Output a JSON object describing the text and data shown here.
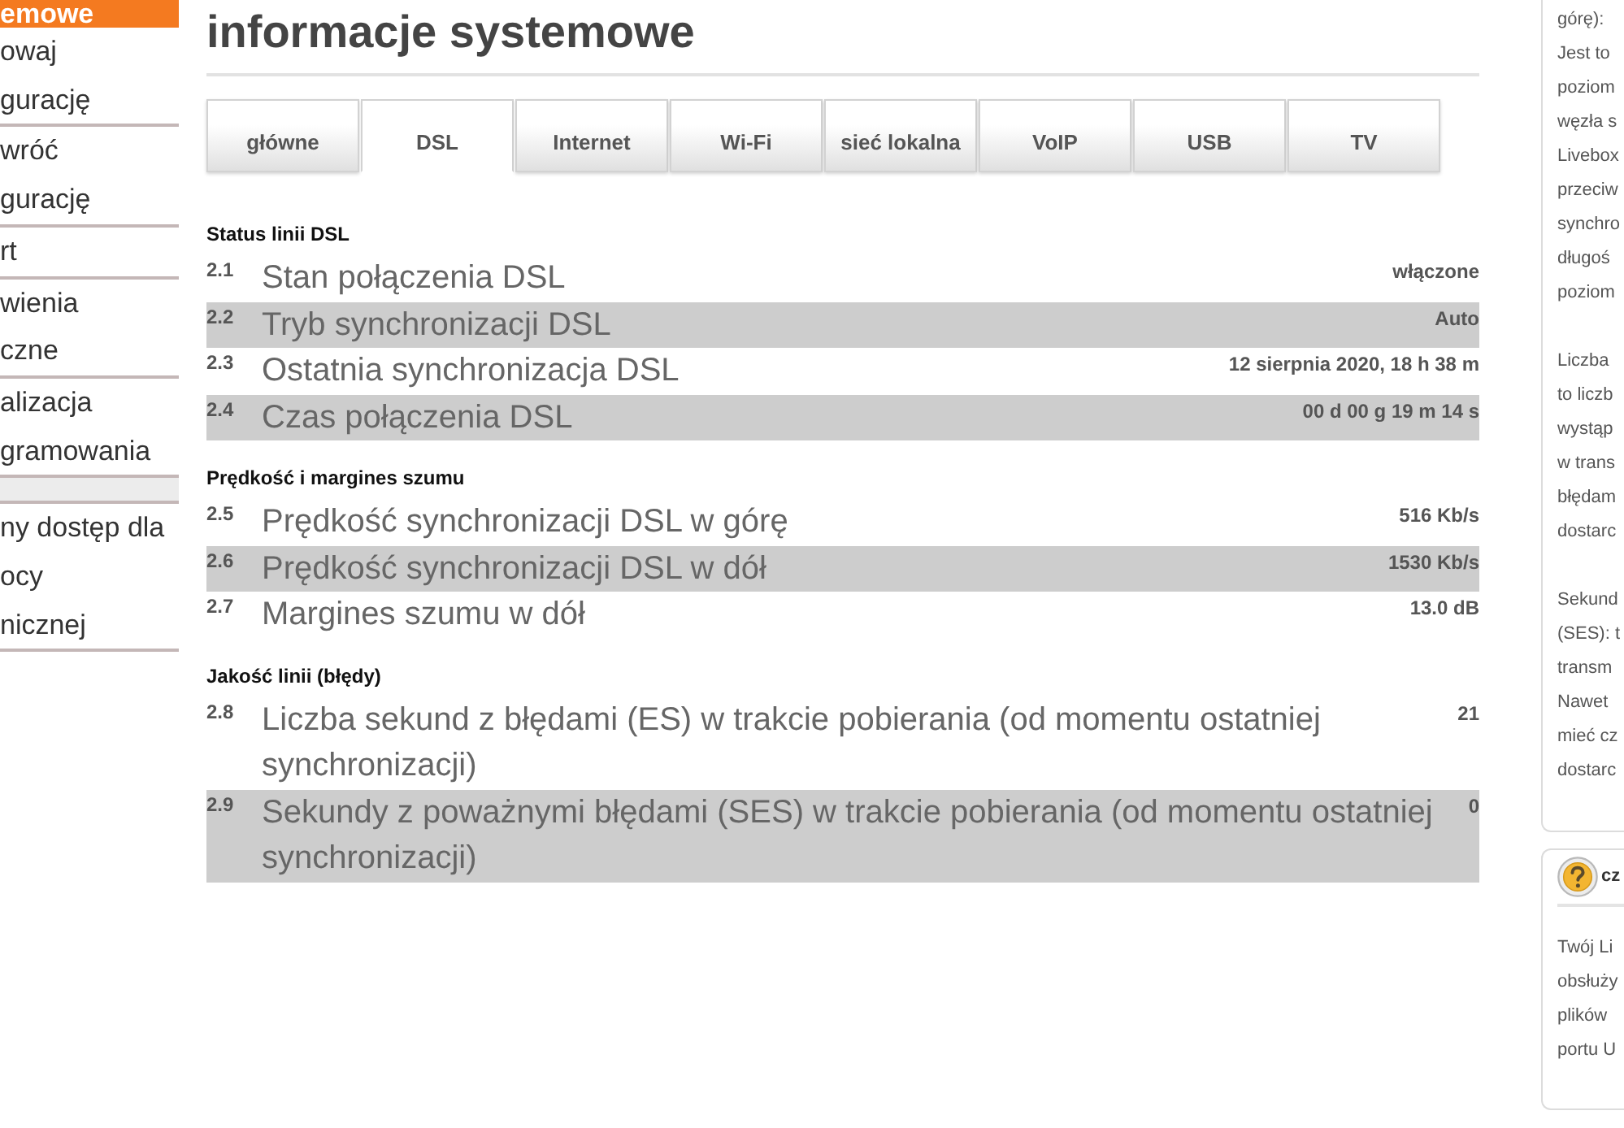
{
  "sidebar": {
    "groups": [
      {
        "items": [
          {
            "lines": [
              "emowe"
            ],
            "selected": true
          },
          {
            "lines": [
              "owaj",
              "gurację"
            ],
            "selected": false
          },
          {
            "lines": [
              "wróć",
              "gurację"
            ],
            "selected": false
          },
          {
            "lines": [
              "rt"
            ],
            "selected": false
          },
          {
            "lines": [
              "wienia",
              "czne"
            ],
            "selected": false
          },
          {
            "lines": [
              "alizacja",
              "gramowania"
            ],
            "selected": false
          }
        ]
      },
      {
        "items": [
          {
            "lines": [
              "ny dostęp dla",
              "ocy",
              "nicznej"
            ],
            "selected": false
          }
        ]
      }
    ]
  },
  "title": "informacje systemowe",
  "tabs": [
    {
      "label": "główne",
      "selected": false
    },
    {
      "label": "DSL",
      "selected": true
    },
    {
      "label": "Internet",
      "selected": false
    },
    {
      "label": "Wi-Fi",
      "selected": false
    },
    {
      "label": "sieć lokalna",
      "selected": false
    },
    {
      "label": "VoIP",
      "selected": false
    },
    {
      "label": "USB",
      "selected": false
    },
    {
      "label": "TV",
      "selected": false
    }
  ],
  "sections": [
    {
      "heading": "Status linii DSL",
      "rows": [
        {
          "number": "2.1",
          "label": "Stan połączenia DSL",
          "value": "włączone"
        },
        {
          "number": "2.2",
          "label": "Tryb synchronizacji DSL",
          "value": "Auto"
        },
        {
          "number": "2.3",
          "label": "Ostatnia synchronizacja DSL",
          "value": "12 sierpnia 2020, 18 h 38 m"
        },
        {
          "number": "2.4",
          "label": "Czas połączenia DSL",
          "value": "00 d 00 g 19 m 14 s"
        }
      ]
    },
    {
      "heading": "Prędkość i margines szumu",
      "rows": [
        {
          "number": "2.5",
          "label": "Prędkość synchronizacji DSL w górę",
          "value": "516 Kb/s"
        },
        {
          "number": "2.6",
          "label": "Prędkość synchronizacji DSL w dół",
          "value": "1530 Kb/s"
        },
        {
          "number": "2.7",
          "label": "Margines szumu w dół",
          "value": "13.0 dB"
        }
      ]
    },
    {
      "heading": "Jakość linii (błędy)",
      "rows": [
        {
          "number": "2.8",
          "label": "Liczba sekund z błędami (ES) w trakcie pobierania (od momentu ostatniej synchronizacji)",
          "value": "21"
        },
        {
          "number": "2.9",
          "label": "Sekundy z poważnymi błędami (SES) w trakcie pobierania (od momentu ostatniej synchronizacji)",
          "value": "0"
        }
      ]
    }
  ],
  "side_panel": {
    "cards": [
      {
        "paragraphs": [
          [
            "górę):",
            "Jest to",
            "poziom",
            "węzła s",
            "Livebox",
            "przeciw",
            "synchro",
            "długoś",
            "poziom"
          ],
          [
            "Liczba",
            "to liczb",
            "wystąp",
            "w trans",
            "błędam",
            "dostarc"
          ],
          [
            "Sekund",
            "(SES): t",
            "transm",
            "Nawet",
            "mieć cz",
            "dostarc"
          ]
        ]
      },
      {
        "title": "cz",
        "paragraphs": [
          [
            "Twój Li",
            "obsłuży",
            "plików",
            "portu U"
          ]
        ]
      }
    ]
  }
}
